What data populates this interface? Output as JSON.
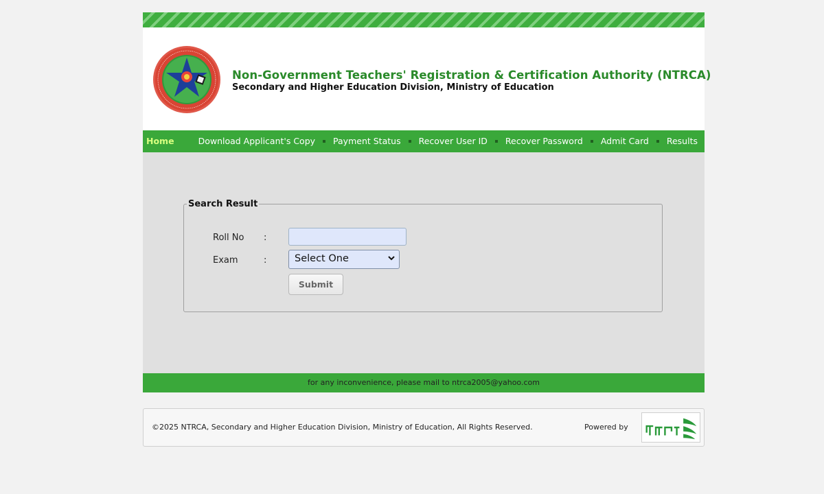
{
  "header": {
    "title": "Non-Government Teachers' Registration & Certification Authority (NTRCA)",
    "subtitle": "Secondary and Higher Education Division, Ministry of Education",
    "logo_icon": "ntrca-seal-icon"
  },
  "nav": {
    "home": "Home",
    "items": [
      "Download Applicant's Copy",
      "Payment Status",
      "Recover User ID",
      "Recover Password",
      "Admit Card",
      "Results"
    ]
  },
  "search": {
    "legend": "Search Result",
    "roll_label": "Roll No",
    "exam_label": "Exam",
    "colon": ":",
    "roll_value": "",
    "exam_selected": "Select One",
    "submit_label": "Submit"
  },
  "footer": {
    "notice": "for any inconvenience, please mail to ntrca2005@yahoo.com",
    "copyright": "©2025 NTRCA, Secondary and Higher Education Division, Ministry of Education, All Rights Reserved.",
    "powered_by": "Powered by",
    "powered_logo_icon": "teletalk-logo-icon"
  },
  "colors": {
    "brand_green": "#3aa83a",
    "title_green": "#2a8a2a",
    "home_link": "#d8ff80",
    "content_bg": "#e0e0e0",
    "input_bg": "#dfe7fb"
  }
}
